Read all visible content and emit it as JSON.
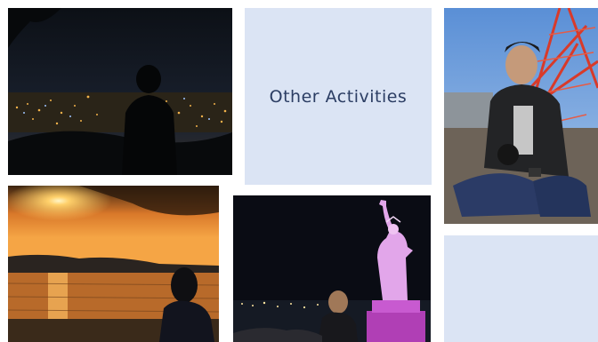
{
  "collage": {
    "title": "Other Activities",
    "accent_color": "#2b3d63",
    "card_color": "#dbe4f4"
  },
  "photos": [
    {
      "name": "night-city-silhouette-photo"
    },
    {
      "name": "tower-portrait-photo"
    },
    {
      "name": "sunset-sea-silhouette-photo"
    },
    {
      "name": "statue-of-liberty-night-photo"
    }
  ]
}
